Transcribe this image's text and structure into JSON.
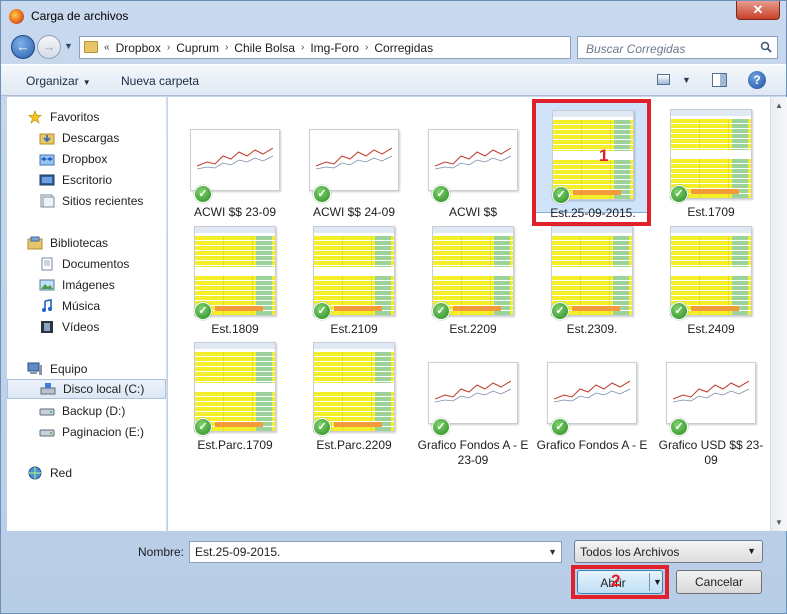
{
  "window": {
    "title": "Carga de archivos"
  },
  "nav": {
    "back_glyph": "←",
    "forward_glyph": "→",
    "overflow": "«",
    "crumbs": [
      "Dropbox",
      "Cuprum",
      "Chile Bolsa",
      "Img-Foro",
      "Corregidas"
    ],
    "search_placeholder": "Buscar Corregidas"
  },
  "toolbar": {
    "organize": "Organizar",
    "new_folder": "Nueva carpeta"
  },
  "sidebar": {
    "favorites": {
      "label": "Favoritos",
      "items": [
        "Descargas",
        "Dropbox",
        "Escritorio",
        "Sitios recientes"
      ]
    },
    "libraries": {
      "label": "Bibliotecas",
      "items": [
        "Documentos",
        "Imágenes",
        "Música",
        "Vídeos"
      ]
    },
    "computer": {
      "label": "Equipo",
      "items": [
        "Disco local (C:)",
        "Backup (D:)",
        "Paginacion (E:)"
      ]
    },
    "network": {
      "label": "Red"
    }
  },
  "files": [
    {
      "name": "ACWI $$ 23-09",
      "kind": "chart"
    },
    {
      "name": "ACWI $$ 24-09",
      "kind": "chart"
    },
    {
      "name": "ACWI $$",
      "kind": "chart"
    },
    {
      "name": "Est.25-09-2015.",
      "kind": "table",
      "selected": true
    },
    {
      "name": "Est.1709",
      "kind": "table"
    },
    {
      "name": "Est.1809",
      "kind": "table"
    },
    {
      "name": "Est.2109",
      "kind": "table"
    },
    {
      "name": "Est.2209",
      "kind": "table"
    },
    {
      "name": "Est.2309.",
      "kind": "table"
    },
    {
      "name": "Est.2409",
      "kind": "table"
    },
    {
      "name": "Est.Parc.1709",
      "kind": "table"
    },
    {
      "name": "Est.Parc.2209",
      "kind": "table"
    },
    {
      "name": "Grafico Fondos A - E 23-09",
      "kind": "chart"
    },
    {
      "name": "Grafico Fondos A - E",
      "kind": "chart"
    },
    {
      "name": "Grafico USD $$ 23-09",
      "kind": "chart"
    }
  ],
  "footer": {
    "name_label": "Nombre:",
    "name_value": "Est.25-09-2015.",
    "filter_value": "Todos los Archivos",
    "open_label": "Abrir",
    "cancel_label": "Cancelar"
  },
  "annotations": {
    "marker_1": "1",
    "marker_2": "2"
  },
  "colors": {
    "highlight": "#e0202a",
    "check": "#2a8a22"
  }
}
